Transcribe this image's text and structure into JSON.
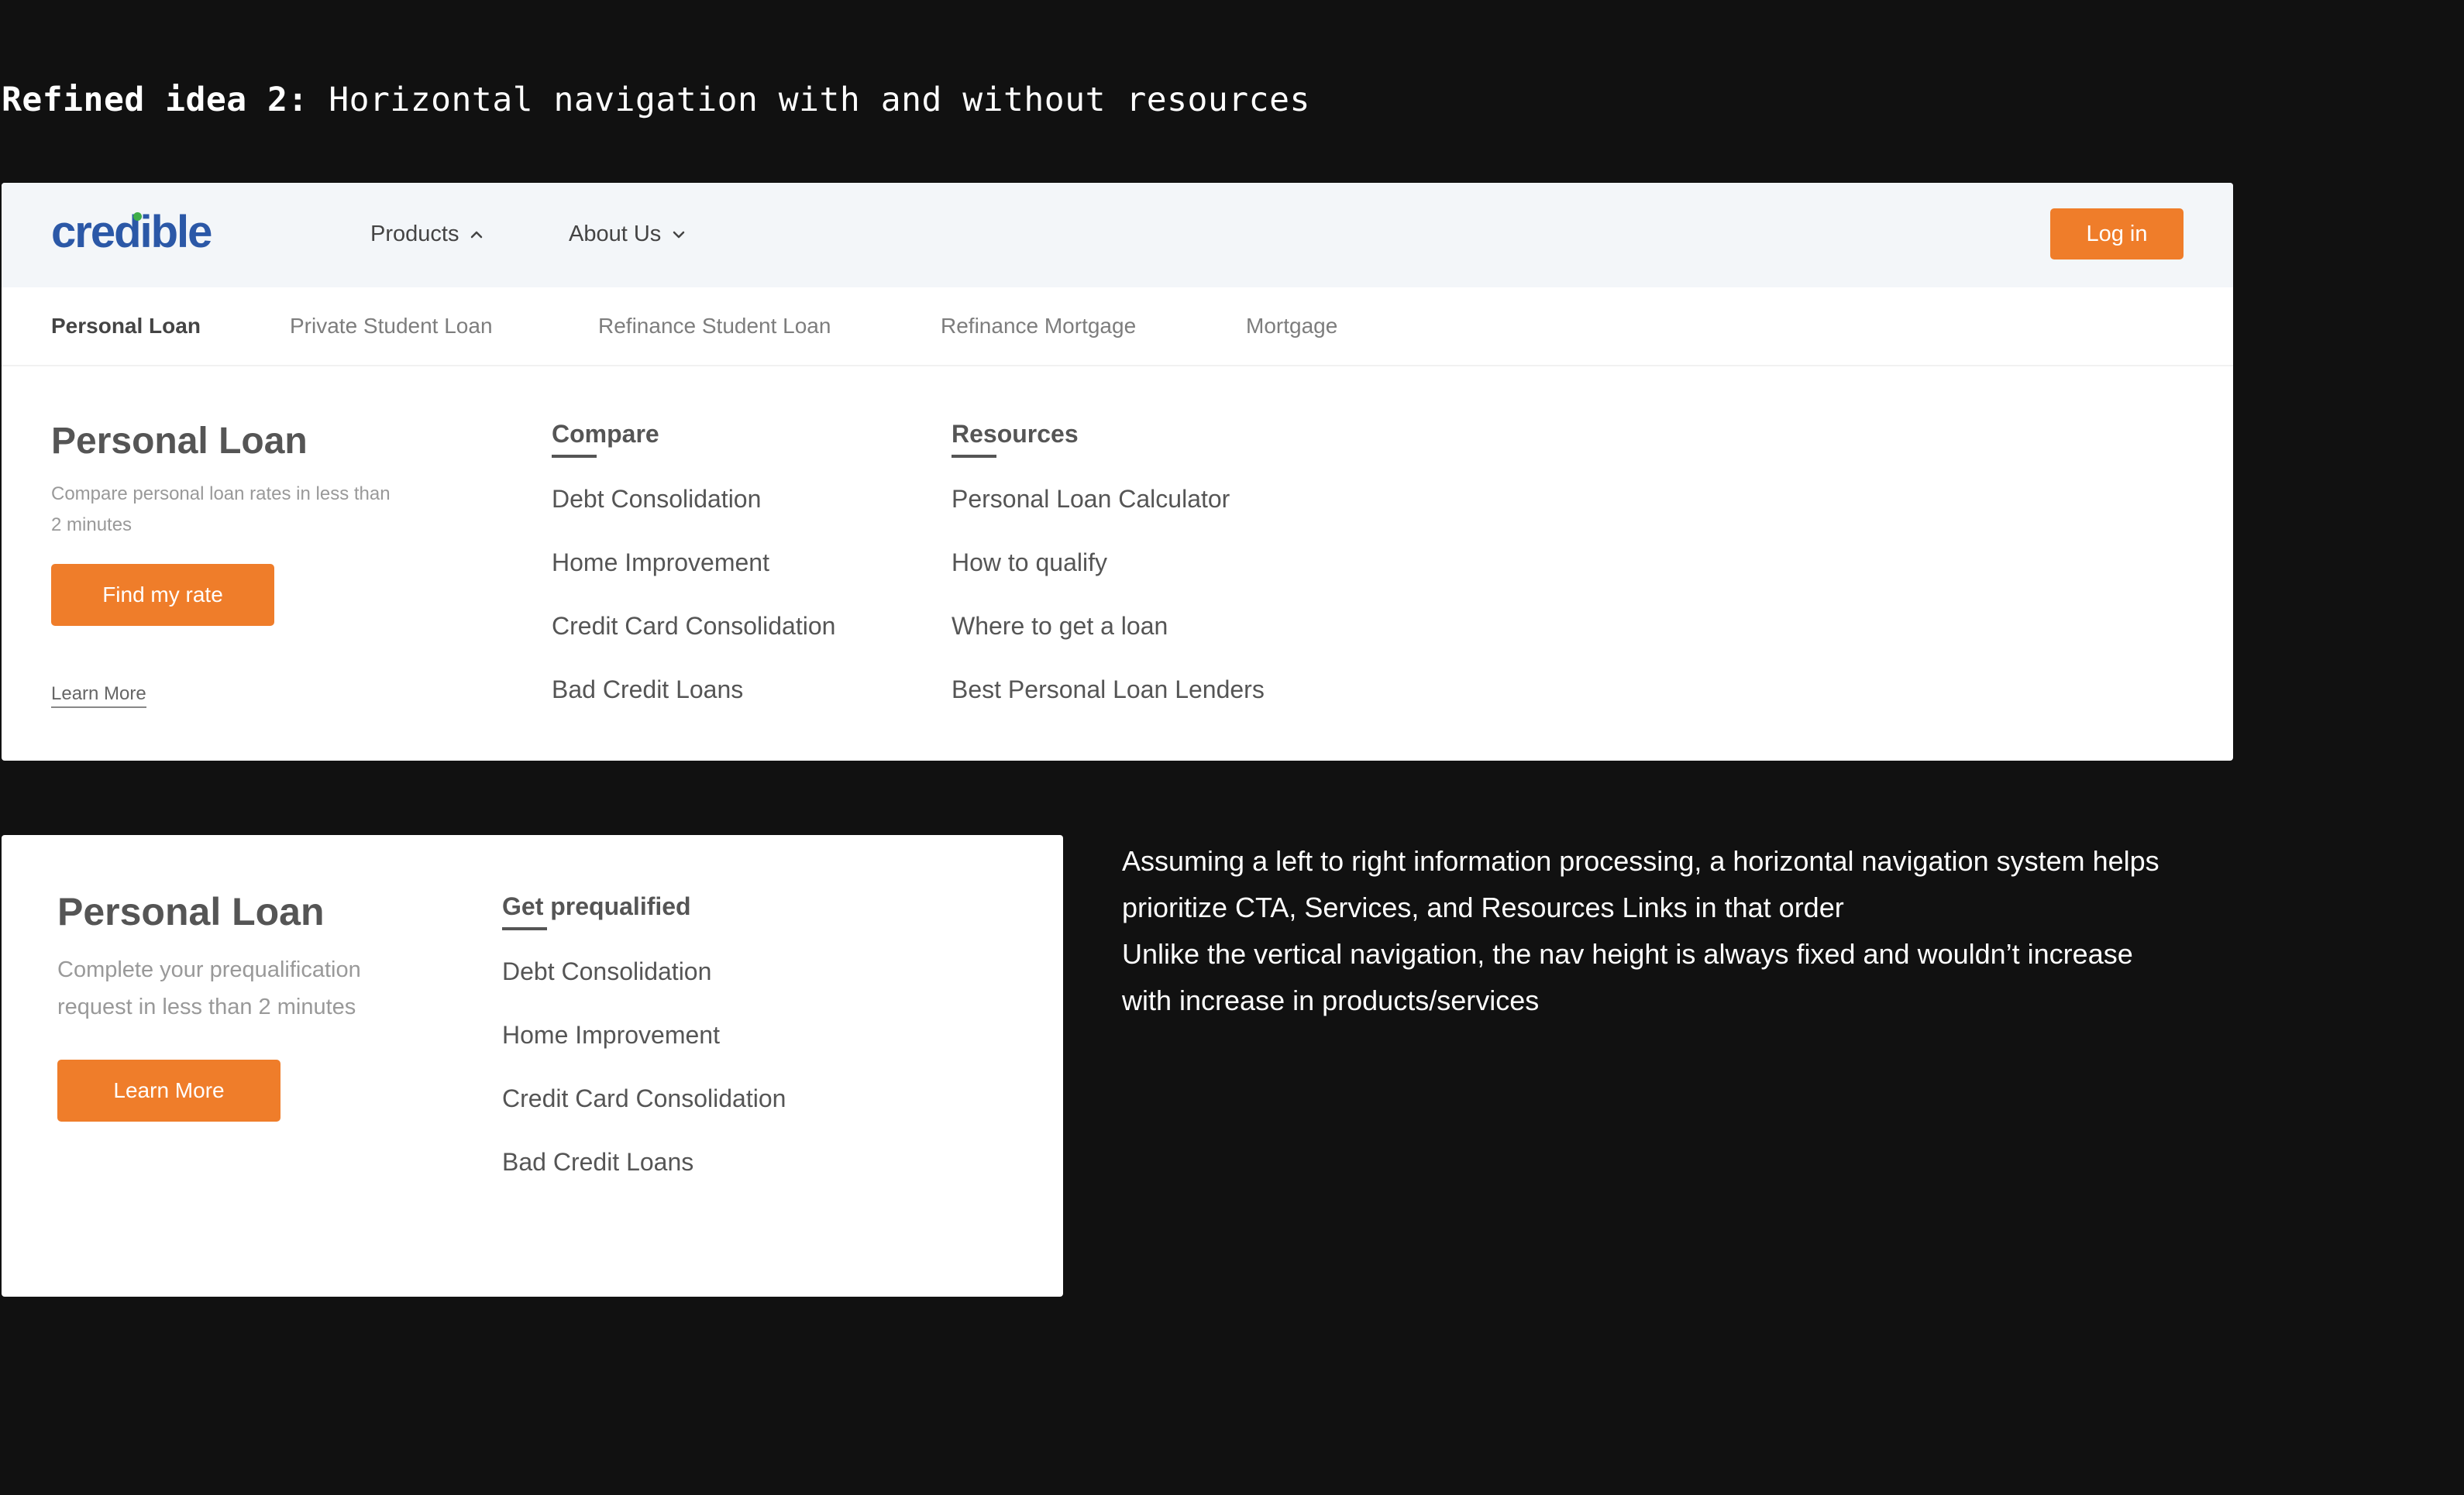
{
  "heading": {
    "bold": "Refined idea 2:",
    "rest": "Horizontal navigation with and without resources"
  },
  "colors": {
    "background": "#111111",
    "brand_blue": "#2b58a7",
    "brand_green": "#3fae49",
    "accent_orange": "#ef7d2a",
    "topbar_bg": "#f3f6f9"
  },
  "panel1": {
    "logo": "credible",
    "topnav": {
      "products": "Products",
      "products_icon": "chevron-up-icon",
      "about": "About Us",
      "about_icon": "chevron-down-icon"
    },
    "login": "Log in",
    "subnav": [
      "Personal Loan",
      "Private Student Loan",
      "Refinance Student Loan",
      "Refinance Mortgage",
      "Mortgage"
    ],
    "subnav_active": "Personal Loan",
    "title": "Personal Loan",
    "desc_line1": "Compare personal loan rates in less than",
    "desc_line2": "2 minutes",
    "cta": "Find my rate",
    "learn_more": "Learn More",
    "compare": {
      "heading": "Compare",
      "links": [
        "Debt Consolidation",
        "Home Improvement",
        "Credit Card Consolidation",
        "Bad Credit Loans"
      ]
    },
    "resources": {
      "heading": "Resources",
      "links": [
        "Personal Loan Calculator",
        "How to qualify",
        "Where to get a loan",
        "Best Personal Loan Lenders"
      ]
    }
  },
  "panel2": {
    "title": "Personal Loan",
    "desc_line1": "Complete your prequalification",
    "desc_line2": "request in less than 2 minutes",
    "cta": "Learn More",
    "prequal": {
      "heading": "Get prequalified",
      "links": [
        "Debt Consolidation",
        "Home Improvement",
        "Credit Card Consolidation",
        "Bad Credit Loans"
      ]
    }
  },
  "explanation": {
    "line1": "Assuming a left to right information processing, a horizontal navigation system helps",
    "line2": "prioritize CTA, Services, and Resources Links in that order",
    "line3": "Unlike the vertical navigation, the nav height is always fixed and wouldn’t increase",
    "line4": "with increase in products/services"
  }
}
